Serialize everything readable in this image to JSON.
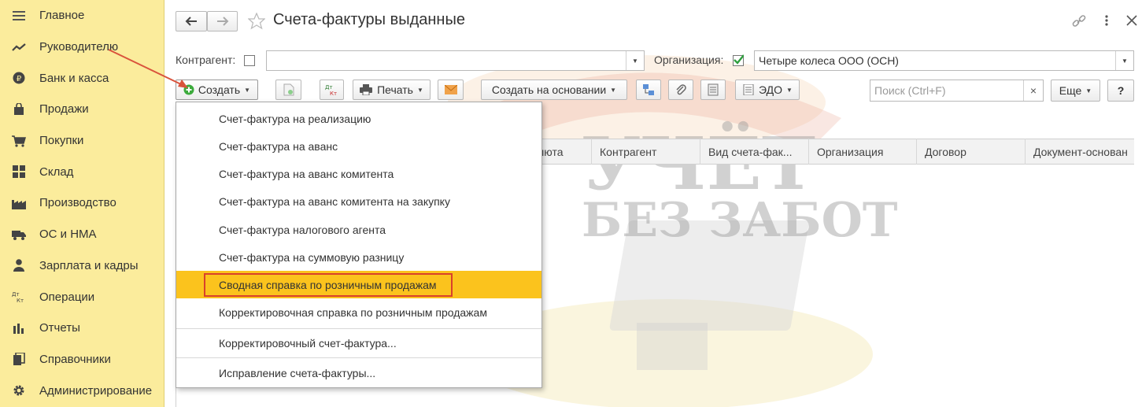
{
  "sidebar": {
    "items": [
      {
        "label": "Главное",
        "icon": "menu-lines-icon"
      },
      {
        "label": "Руководителю",
        "icon": "trend-chart-icon"
      },
      {
        "label": "Банк и касса",
        "icon": "ruble-coin-icon"
      },
      {
        "label": "Продажи",
        "icon": "shopping-bag-icon"
      },
      {
        "label": "Покупки",
        "icon": "shopping-cart-icon"
      },
      {
        "label": "Склад",
        "icon": "warehouse-grid-icon"
      },
      {
        "label": "Производство",
        "icon": "factory-icon"
      },
      {
        "label": "ОС и НМА",
        "icon": "truck-icon"
      },
      {
        "label": "Зарплата и кадры",
        "icon": "person-icon"
      },
      {
        "label": "Операции",
        "icon": "dt-kt-icon"
      },
      {
        "label": "Отчеты",
        "icon": "bar-chart-icon"
      },
      {
        "label": "Справочники",
        "icon": "books-icon"
      },
      {
        "label": "Администрирование",
        "icon": "gear-icon"
      }
    ],
    "dtkt_top": "Дт",
    "dtkt_bottom": "Кт"
  },
  "header": {
    "title": "Счета-фактуры выданные"
  },
  "filters": {
    "counterparty_label": "Контрагент:",
    "counterparty_checked": false,
    "counterparty_value": "",
    "organization_label": "Организация:",
    "organization_checked": true,
    "organization_value": "Четыре колеса ООО (ОСН)"
  },
  "toolbar": {
    "create_label": "Создать",
    "dtkt_top": "Дт",
    "dtkt_bottom": "Кт",
    "print_label": "Печать",
    "create_based_label": "Создать на основании",
    "edo_label": "ЭДО",
    "search_placeholder": "Поиск (Ctrl+F)",
    "search_clear": "×",
    "more_label": "Еще",
    "help_label": "?"
  },
  "table": {
    "columns": [
      "Валюта",
      "Контрагент",
      "Вид счета-фак...",
      "Организация",
      "Договор",
      "Документ-основан"
    ]
  },
  "create_menu": {
    "items": [
      "Счет-фактура на реализацию",
      "Счет-фактура на аванс",
      "Счет-фактура на аванс комитента",
      "Счет-фактура на аванс комитента на закупку",
      "Счет-фактура налогового агента",
      "Счет-фактура на суммовую разницу",
      "Сводная справка по розничным продажам",
      "Корректировочная справка по розничным продажам"
    ],
    "highlighted_index": 6,
    "extra_items": [
      "Корректировочный счет-фактура...",
      "Исправление счета-фактуры..."
    ]
  },
  "watermark": {
    "line1": "УЧЁТ",
    "line2": "БЕЗ ЗАБОТ"
  },
  "colors": {
    "sidebar_bg": "#fbec9c",
    "highlight": "#fbc31d",
    "annotation_red": "#d9412b",
    "checkbox_green": "#2e9e3e",
    "create_icon_green": "#3cab3c"
  }
}
